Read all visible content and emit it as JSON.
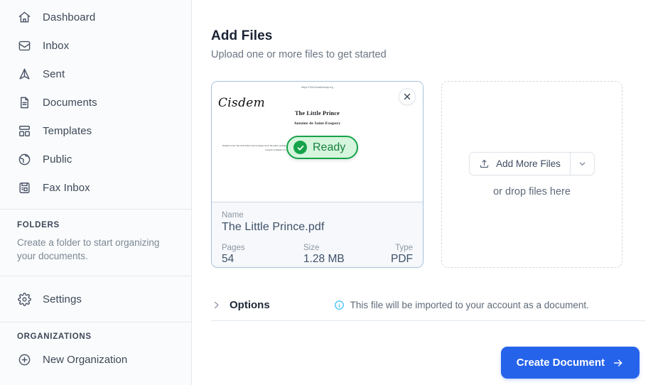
{
  "sidebar": {
    "nav_items": [
      {
        "label": "Dashboard",
        "icon": "home-icon"
      },
      {
        "label": "Inbox",
        "icon": "inbox-icon"
      },
      {
        "label": "Sent",
        "icon": "send-icon"
      },
      {
        "label": "Documents",
        "icon": "document-icon"
      },
      {
        "label": "Templates",
        "icon": "templates-icon"
      },
      {
        "label": "Public",
        "icon": "globe-icon"
      },
      {
        "label": "Fax Inbox",
        "icon": "fax-icon"
      }
    ],
    "folders": {
      "title": "FOLDERS",
      "description": "Create a folder to start organizing your documents."
    },
    "settings": {
      "label": "Settings",
      "icon": "gear-icon"
    },
    "organizations": {
      "title": "ORGANIZATIONS",
      "new_org_label": "New Organization",
      "new_org_icon": "plus-circle-icon"
    }
  },
  "main": {
    "title": "Add Files",
    "subtitle": "Upload one or more files to get started",
    "file_card": {
      "status_badge": "Ready",
      "status_icon": "check-circle-icon",
      "close_icon": "close-icon",
      "thumbnail": {
        "url_line": "https://TheVirtualLibrary.org",
        "logo": "Cisdem",
        "title": "The Little Prince",
        "author": "Antoine de Saint-Exupery",
        "fine_print": "Original work: The Little Prince and its images are in the public domain. This translation is Copyright by Cisdem Ltd. and licensed under Creative Commons CC-BY-NC-ND 4.0"
      },
      "fields": [
        {
          "label": "Name",
          "value": "The Little Prince.pdf"
        },
        {
          "label": "Pages",
          "value": "54"
        },
        {
          "label": "Size",
          "value": "1.28 MB"
        },
        {
          "label": "Type",
          "value": "PDF"
        }
      ]
    },
    "dropzone": {
      "add_more_label": "Add More Files",
      "upload_icon": "upload-icon",
      "caret_icon": "chevron-down-icon",
      "drop_hint": "or drop files here"
    },
    "options": {
      "label": "Options",
      "chevron_icon": "chevron-right-icon",
      "info_icon": "info-icon",
      "info_text": "This file will be imported to your account as a document."
    },
    "footer": {
      "primary_label": "Create Document",
      "primary_icon": "arrow-right-icon"
    }
  },
  "colors": {
    "accent": "#2563eb",
    "success": "#16a34a",
    "success_bg": "#d6f5dd",
    "info": "#38bdf8",
    "sidebar_bg": "#fafbfc",
    "border": "#e3e8ef"
  }
}
